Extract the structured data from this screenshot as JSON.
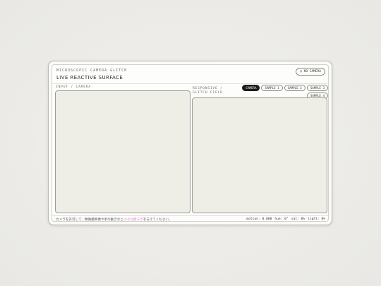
{
  "header": {
    "subtitle": "MICROSCOPIC CAMERA GLITCH",
    "title": "LIVE REACTIVE SURFACE",
    "no_camera_label": "◎ NO CAMERA"
  },
  "input_panel": {
    "label": "INPUT / CAMERA"
  },
  "glitch_panel": {
    "label": "RESPONSIVE / GLITCH FIELD",
    "sources": [
      {
        "label": "CAMERA",
        "active": true
      },
      {
        "label": "SAMPLE 1",
        "active": false
      },
      {
        "label": "SAMPLE 2",
        "active": false
      },
      {
        "label": "SAMPLE 3",
        "active": false
      },
      {
        "label": "SAMPLE 4",
        "active": false
      }
    ]
  },
  "footer": {
    "note_before": "カメラを許可して、顕微鏡映像や手の動きなど",
    "note_highlight": "小さな揺らぎ",
    "note_after": "を与えてください。",
    "status": {
      "motion": "motion: 0.000",
      "hue": "hue: 0°",
      "sat": "sat: 0%",
      "light": "light: 0%"
    }
  },
  "colors": {
    "accent_highlight": "#e27ad6",
    "active_chip": "#1b1b1a",
    "viewport_fill": "#efeee6"
  }
}
